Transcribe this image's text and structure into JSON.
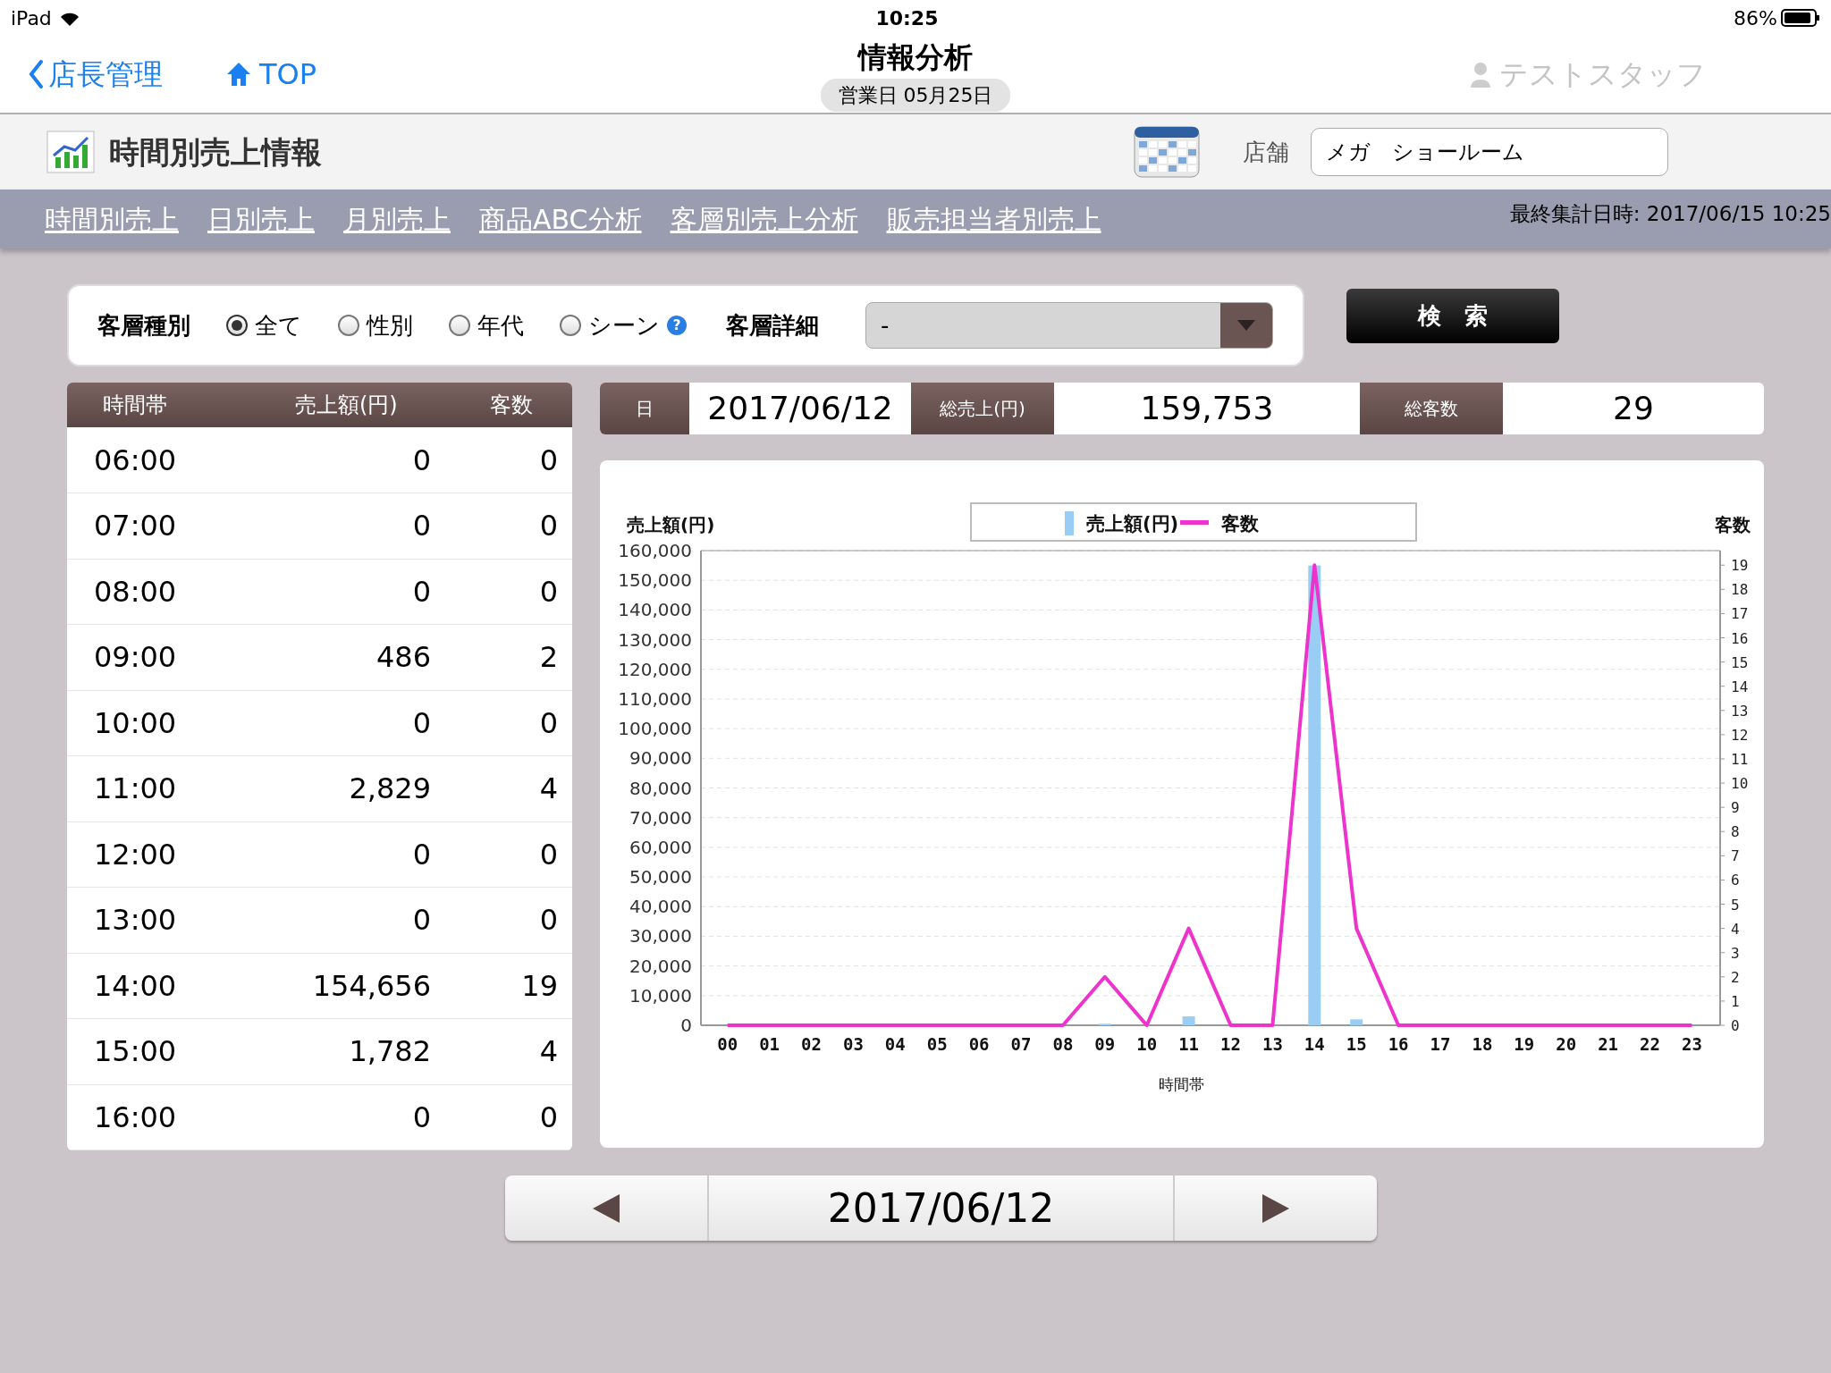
{
  "status_bar": {
    "device": "iPad",
    "time": "10:25",
    "battery": "86%"
  },
  "nav_bar": {
    "back": "店長管理",
    "home": "TOP",
    "title": "情報分析",
    "subtitle": "営業日 05月25日",
    "user": "テストスタッフ"
  },
  "page_header": {
    "title": "時間別売上情報",
    "store_label": "店舗",
    "store_value": "メガ　ショールーム"
  },
  "tabs": [
    "時間別売上",
    "日別売上",
    "月別売上",
    "商品ABC分析",
    "客層別売上分析",
    "販売担当者別売上"
  ],
  "last_updated": "最終集計日時: 2017/06/15 10:25",
  "filter": {
    "type_label": "客層種別",
    "options": [
      {
        "label": "全て",
        "selected": true
      },
      {
        "label": "性別",
        "selected": false
      },
      {
        "label": "年代",
        "selected": false
      },
      {
        "label": "シーン",
        "selected": false,
        "help": "?"
      }
    ],
    "detail_label": "客層詳細",
    "detail_value": "-"
  },
  "search_button": "検　索",
  "table": {
    "columns": [
      "時間帯",
      "売上額(円)",
      "客数"
    ],
    "rows": [
      [
        "06:00",
        "0",
        "0"
      ],
      [
        "07:00",
        "0",
        "0"
      ],
      [
        "08:00",
        "0",
        "0"
      ],
      [
        "09:00",
        "486",
        "2"
      ],
      [
        "10:00",
        "0",
        "0"
      ],
      [
        "11:00",
        "2,829",
        "4"
      ],
      [
        "12:00",
        "0",
        "0"
      ],
      [
        "13:00",
        "0",
        "0"
      ],
      [
        "14:00",
        "154,656",
        "19"
      ],
      [
        "15:00",
        "1,782",
        "4"
      ],
      [
        "16:00",
        "0",
        "0"
      ]
    ]
  },
  "summary": [
    {
      "label": "日",
      "value": "2017/06/12"
    },
    {
      "label": "総売上(円)",
      "value": "159,753"
    },
    {
      "label": "総客数",
      "value": "29"
    }
  ],
  "chart": {
    "chart_data": {
      "type": "bar",
      "grid": true,
      "legend": true,
      "xlabel": "時間帯",
      "ylabel": "売上額(円)",
      "y2label": "客数",
      "categories": [
        "00",
        "01",
        "02",
        "03",
        "04",
        "05",
        "06",
        "07",
        "08",
        "09",
        "10",
        "11",
        "12",
        "13",
        "14",
        "15",
        "16",
        "17",
        "18",
        "19",
        "20",
        "21",
        "22",
        "23"
      ],
      "series": [
        {
          "name": "売上額(円)",
          "color": "#99cdf3",
          "type": "bar",
          "values": [
            0,
            0,
            0,
            0,
            0,
            0,
            0,
            0,
            0,
            500,
            0,
            3000,
            0,
            0,
            155000,
            2000,
            0,
            0,
            0,
            0,
            0,
            0,
            0,
            0
          ]
        },
        {
          "name": "客数",
          "color": "#ee33cc",
          "type": "line",
          "axis": "y2",
          "values": [
            0,
            0,
            0,
            0,
            0,
            0,
            0,
            0,
            0,
            2,
            0,
            4,
            0,
            0,
            19,
            4,
            0,
            0,
            0,
            0,
            0,
            0,
            0,
            0
          ]
        }
      ],
      "ylim": [
        0,
        160000
      ],
      "yticks": [
        {
          "value": 0,
          "label": "0"
        },
        {
          "value": 10000,
          "label": "10,000"
        },
        {
          "value": 20000,
          "label": "20,000"
        },
        {
          "value": 30000,
          "label": "30,000"
        },
        {
          "value": 40000,
          "label": "40,000"
        },
        {
          "value": 50000,
          "label": "50,000"
        },
        {
          "value": 60000,
          "label": "60,000"
        },
        {
          "value": 70000,
          "label": "70,000"
        },
        {
          "value": 80000,
          "label": "80,000"
        },
        {
          "value": 90000,
          "label": "90,000"
        },
        {
          "value": 100000,
          "label": "100,000"
        },
        {
          "value": 110000,
          "label": "110,000"
        },
        {
          "value": 120000,
          "label": "120,000"
        },
        {
          "value": 130000,
          "label": "130,000"
        },
        {
          "value": 140000,
          "label": "140,000"
        },
        {
          "value": 150000,
          "label": "150,000"
        },
        {
          "value": 160000,
          "label": "160,000"
        }
      ],
      "y2lim": [
        0,
        19.6
      ],
      "y2ticks": [
        0,
        1,
        2,
        3,
        4,
        5,
        6,
        7,
        8,
        9,
        10,
        11,
        12,
        13,
        14,
        15,
        16,
        17,
        18,
        19
      ]
    }
  },
  "date_nav": {
    "date": "2017/06/12"
  }
}
